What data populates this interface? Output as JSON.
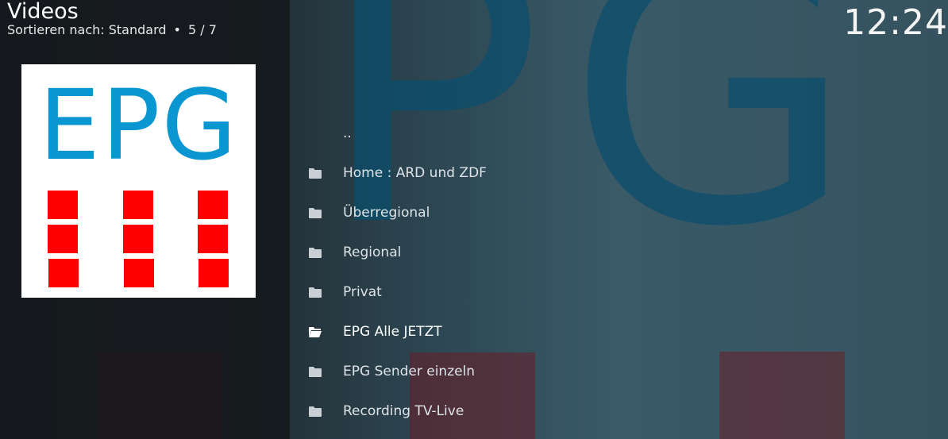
{
  "header": {
    "title": "Videos",
    "sort_label": "Sortieren nach: Standard",
    "separator": "•",
    "position": "5 / 7"
  },
  "clock": {
    "time": "12:24"
  },
  "thumbnail": {
    "logo_text": "EPG",
    "logo_color": "#0a96d0",
    "square_color": "#ff0000"
  },
  "list": {
    "items": [
      {
        "label": "..",
        "icon": "parent-folder",
        "focused": false
      },
      {
        "label": "Home : ARD und ZDF",
        "icon": "folder-icon",
        "focused": false
      },
      {
        "label": "Überregional",
        "icon": "folder-icon",
        "focused": false
      },
      {
        "label": "Regional",
        "icon": "folder-icon",
        "focused": false
      },
      {
        "label": "Privat",
        "icon": "folder-icon",
        "focused": false
      },
      {
        "label": "EPG Alle JETZT",
        "icon": "folder-open-icon",
        "focused": true
      },
      {
        "label": "EPG Sender einzeln",
        "icon": "folder-icon",
        "focused": false
      },
      {
        "label": "Recording TV-Live",
        "icon": "folder-icon",
        "focused": false
      }
    ]
  },
  "colors": {
    "background": "#1b2328",
    "fanart_letters": "#0b4e6c",
    "text": "#ffffff"
  }
}
